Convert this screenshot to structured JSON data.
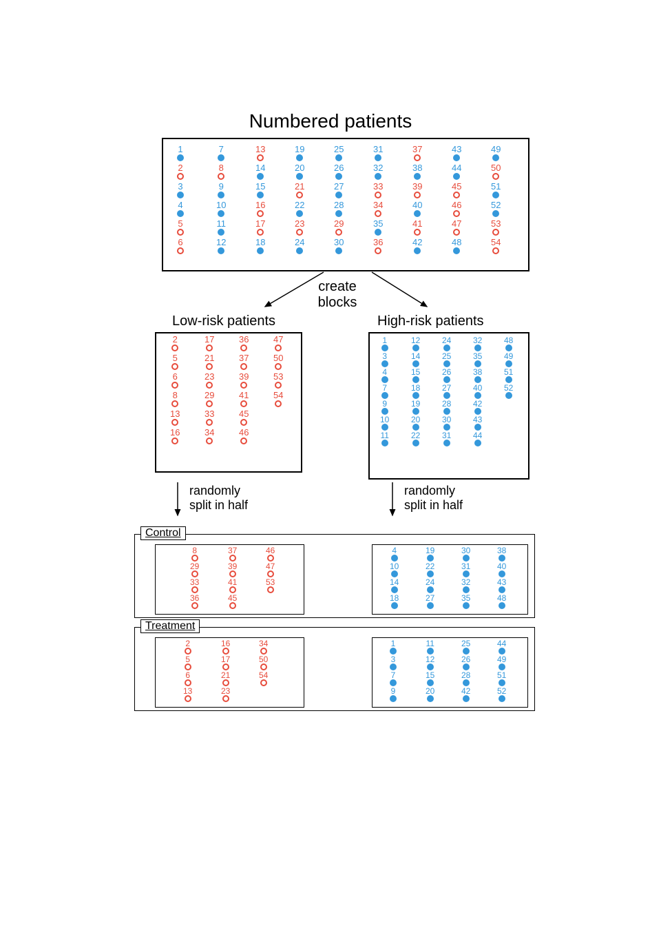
{
  "title": "Numbered patients",
  "labels": {
    "create_blocks": "create\nblocks",
    "low_risk": "Low-risk patients",
    "high_risk": "High-risk patients",
    "split_left": "randomly\nsplit in half",
    "split_right": "randomly\nsplit in half",
    "control": "Control",
    "treatment": "Treatment"
  },
  "patients": {
    "all_cols": [
      [
        [
          1,
          "high"
        ],
        [
          2,
          "low"
        ],
        [
          3,
          "high"
        ],
        [
          4,
          "high"
        ],
        [
          5,
          "low"
        ],
        [
          6,
          "low"
        ]
      ],
      [
        [
          7,
          "high"
        ],
        [
          8,
          "low"
        ],
        [
          9,
          "high"
        ],
        [
          10,
          "high"
        ],
        [
          11,
          "high"
        ],
        [
          12,
          "high"
        ]
      ],
      [
        [
          13,
          "low"
        ],
        [
          14,
          "high"
        ],
        [
          15,
          "high"
        ],
        [
          16,
          "low"
        ],
        [
          17,
          "low"
        ],
        [
          18,
          "high"
        ]
      ],
      [
        [
          19,
          "high"
        ],
        [
          20,
          "high"
        ],
        [
          21,
          "low"
        ],
        [
          22,
          "high"
        ],
        [
          23,
          "low"
        ],
        [
          24,
          "high"
        ]
      ],
      [
        [
          25,
          "high"
        ],
        [
          26,
          "high"
        ],
        [
          27,
          "high"
        ],
        [
          28,
          "high"
        ],
        [
          29,
          "low"
        ],
        [
          30,
          "high"
        ]
      ],
      [
        [
          31,
          "high"
        ],
        [
          32,
          "high"
        ],
        [
          33,
          "low"
        ],
        [
          34,
          "low"
        ],
        [
          35,
          "high"
        ],
        [
          36,
          "low"
        ]
      ],
      [
        [
          37,
          "low"
        ],
        [
          38,
          "high"
        ],
        [
          39,
          "low"
        ],
        [
          40,
          "high"
        ],
        [
          41,
          "low"
        ],
        [
          42,
          "high"
        ]
      ],
      [
        [
          43,
          "high"
        ],
        [
          44,
          "high"
        ],
        [
          45,
          "low"
        ],
        [
          46,
          "low"
        ],
        [
          47,
          "low"
        ],
        [
          48,
          "high"
        ]
      ],
      [
        [
          49,
          "high"
        ],
        [
          50,
          "low"
        ],
        [
          51,
          "high"
        ],
        [
          52,
          "high"
        ],
        [
          53,
          "low"
        ],
        [
          54,
          "low"
        ]
      ]
    ],
    "low_cols": [
      [
        2,
        5,
        6,
        8,
        13,
        16
      ],
      [
        17,
        21,
        23,
        29,
        33,
        34
      ],
      [
        36,
        37,
        39,
        41,
        45,
        46
      ],
      [
        47,
        50,
        53,
        54
      ]
    ],
    "high_cols": [
      [
        1,
        3,
        4,
        7,
        9,
        10,
        11
      ],
      [
        12,
        14,
        15,
        18,
        19,
        20,
        22
      ],
      [
        24,
        25,
        26,
        27,
        28,
        30,
        31
      ],
      [
        32,
        35,
        38,
        40,
        42,
        43,
        44
      ],
      [
        48,
        49,
        51,
        52
      ]
    ],
    "control_low_cols": [
      [
        8,
        29,
        33,
        36
      ],
      [
        37,
        39,
        41,
        45
      ],
      [
        46,
        47,
        53
      ]
    ],
    "control_high_cols": [
      [
        4,
        10,
        14,
        18
      ],
      [
        19,
        22,
        24,
        27
      ],
      [
        30,
        31,
        32,
        35
      ],
      [
        38,
        40,
        43,
        48
      ]
    ],
    "treat_low_cols": [
      [
        2,
        5,
        6,
        13
      ],
      [
        16,
        17,
        21,
        23
      ],
      [
        34,
        50,
        54
      ]
    ],
    "treat_high_cols": [
      [
        1,
        3,
        7,
        9
      ],
      [
        11,
        12,
        15,
        20
      ],
      [
        25,
        26,
        28,
        42
      ],
      [
        44,
        49,
        51,
        52
      ]
    ]
  }
}
